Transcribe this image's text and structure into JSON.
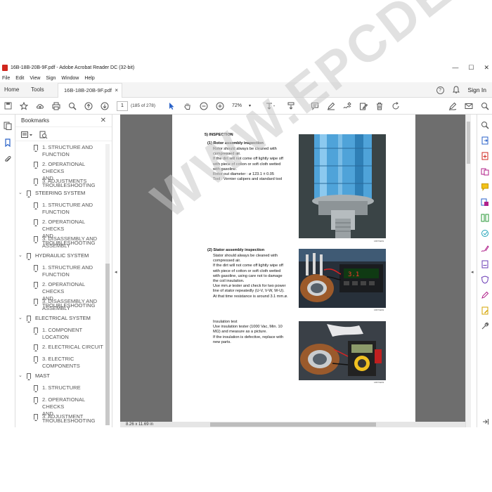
{
  "window": {
    "title": "16B-18B-20B-9F.pdf - Adobe Acrobat Reader DC (32-bit)",
    "controls": [
      "—",
      "☐",
      "✕"
    ]
  },
  "menu": [
    "File",
    "Edit",
    "View",
    "Sign",
    "Window",
    "Help"
  ],
  "tabs": {
    "home": "Home",
    "tools": "Tools",
    "document": "16B-18B-20B-9F.pdf",
    "close": "×",
    "help": "?",
    "sign_in": "Sign In"
  },
  "toolbar": {
    "page_current": "1",
    "page_of": "(185 of 278)",
    "zoom": "72%"
  },
  "bookmarks": {
    "title": "Bookmarks",
    "close": "✕",
    "items": [
      {
        "indent": 1,
        "label1": "1. STRUCTURE AND",
        "label2": "FUNCTION"
      },
      {
        "indent": 1,
        "label1": "2. OPERATIONAL CHECKS",
        "label2": "AND TROUBLESHOOTING"
      },
      {
        "indent": 1,
        "label1": "3. ADJUSTMENTS",
        "label2": ""
      },
      {
        "indent": 0,
        "label1": "STEERING SYSTEM",
        "label2": ""
      },
      {
        "indent": 1,
        "label1": "1. STRUCTURE AND",
        "label2": "FUNCTION"
      },
      {
        "indent": 1,
        "label1": "2. OPERATIONAL CHECKS",
        "label2": "AND TROUBLESHOOTING"
      },
      {
        "indent": 1,
        "label1": "3. DISASSEMBLY AND",
        "label2": "ASSEMBLY"
      },
      {
        "indent": 0,
        "label1": "HYDRAULIC SYSTEM",
        "label2": ""
      },
      {
        "indent": 1,
        "label1": "1. STRUCTURE AND",
        "label2": "FUNCTION"
      },
      {
        "indent": 1,
        "label1": "2. OPERATIONAL CHECKS",
        "label2": "AND TROUBLESHOOTING"
      },
      {
        "indent": 1,
        "label1": "3. DISASSEMBLY AND",
        "label2": "ASSEMBLY"
      },
      {
        "indent": 0,
        "label1": "ELECTRICAL SYSTEM",
        "label2": ""
      },
      {
        "indent": 1,
        "label1": "1. COMPONENT",
        "label2": "LOCATION"
      },
      {
        "indent": 1,
        "label1": "2. ELECTRICAL CIRCUIT",
        "label2": ""
      },
      {
        "indent": 1,
        "label1": "3. ELECTRIC",
        "label2": "COMPONENTS"
      },
      {
        "indent": 0,
        "label1": "MAST",
        "label2": ""
      },
      {
        "indent": 1,
        "label1": "1. STRUCTURE",
        "label2": ""
      },
      {
        "indent": 1,
        "label1": "2. OPERATIONAL CHECKS",
        "label2": "AND TROUBLESHOOTING"
      },
      {
        "indent": 1,
        "label1": "3. ADJUSTMENT",
        "label2": ""
      }
    ]
  },
  "status": {
    "page_size": "8.26 x 11.69 in"
  },
  "document": {
    "heading": "5) INSPECTION",
    "sec1_title": "(1) Rotor assembly inspection",
    "sec1_lines": [
      "Rotor should always be cleaned with",
      "compressed air.",
      "If the dirt will not come off lightly wipe off",
      "with piece of cotton or soft cloth wetted",
      "with gasoline.",
      "Rotor out diameter : ø 123.1 ± 0.05",
      "Tool : Vernier calipers and standard tool"
    ],
    "sec2_title": "(2) Stator assembly inspection",
    "sec2_lines": [
      "Stator should always be cleaned with",
      "compressed air.",
      "If the dirt will not come off lightly wipe off",
      "with piece of cotton or soft cloth wetted",
      "with gasoline, using care not to damage",
      "the coil insulation.",
      "Use mm.ø tester and check for two power",
      "line of stator repeatedly (U-V, V-W, W-U).",
      "At that time resistance is around 3.1 mm.ø."
    ],
    "sec3_lines": [
      "Insulation test",
      "Use insulation tester (1000 Vac, Min. 10",
      "MΩ) and measure as a picture.",
      "If the insulation is defective, replace with",
      "new parts."
    ],
    "captions": [
      "16B7SE51",
      "16B7SE52",
      "16B7SE53"
    ]
  },
  "watermark": "WWW.EPCDEPO.COM"
}
